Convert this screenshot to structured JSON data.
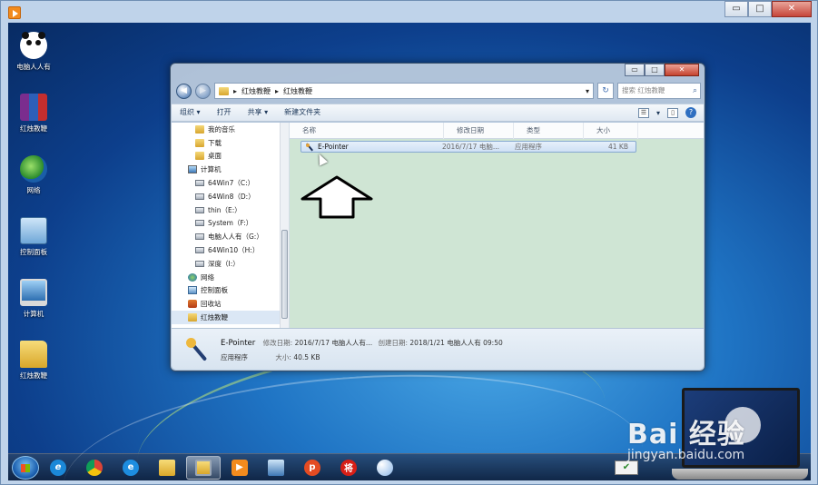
{
  "frame": {
    "controls": [
      "▭",
      "□",
      "✕"
    ]
  },
  "desktop": {
    "icons": [
      {
        "label": "电脑人人有",
        "icon": "panda-icon"
      },
      {
        "label": "红烛教鞭",
        "icon": "winrar-icon"
      },
      {
        "label": "网络",
        "icon": "network-icon"
      },
      {
        "label": "控制面板",
        "icon": "control-panel-icon"
      },
      {
        "label": "计算机",
        "icon": "computer-icon"
      },
      {
        "label": "红烛教鞭",
        "icon": "folder-icon"
      }
    ]
  },
  "explorer": {
    "controls": [
      "▭",
      "□",
      "✕"
    ],
    "back": "◀",
    "forward": "▶",
    "address": {
      "sep": "▸",
      "crumbs": [
        "红烛教鞭",
        "红烛教鞭"
      ],
      "dropdown": "▾"
    },
    "refresh": "↻",
    "search_placeholder": "搜索 红烛教鞭",
    "search_icon": "⌕",
    "toolbar": {
      "organize": "组织 ▾",
      "open": "打开",
      "share": "共享 ▾",
      "new_folder": "新建文件夹",
      "view": "☰",
      "view_dd": "▾",
      "pane": "▯",
      "help": "?"
    },
    "nav": [
      {
        "label": "我的音乐",
        "icon": "folder"
      },
      {
        "label": "下载",
        "icon": "folder"
      },
      {
        "label": "桌面",
        "icon": "folder"
      },
      {
        "label": "计算机",
        "icon": "computer"
      },
      {
        "label": "64Win7（C:）",
        "icon": "drive"
      },
      {
        "label": "64Win8（D:）",
        "icon": "drive"
      },
      {
        "label": "thin（E:）",
        "icon": "drive"
      },
      {
        "label": "System（F:）",
        "icon": "drive"
      },
      {
        "label": "电脑人人有（G:）",
        "icon": "drive"
      },
      {
        "label": "64Win10（H:）",
        "icon": "drive"
      },
      {
        "label": "深度（I:）",
        "icon": "drive"
      },
      {
        "label": "网络",
        "icon": "network"
      },
      {
        "label": "控制面板",
        "icon": "control-panel"
      },
      {
        "label": "回收站",
        "icon": "recycle-bin"
      },
      {
        "label": "红烛教鞭",
        "icon": "folder"
      }
    ],
    "columns": [
      "名称",
      "修改日期",
      "类型",
      "大小"
    ],
    "file": {
      "name": "E-Pointer",
      "date": "2016/7/17 电脑...",
      "type": "应用程序",
      "size": "41 KB"
    },
    "details": {
      "name": "E-Pointer",
      "modified_label": "修改日期:",
      "modified": "2016/7/17 电脑人人有...",
      "created_label": "创建日期:",
      "created": "2018/1/21 电脑人人有 09:50",
      "type": "应用程序",
      "size_label": "大小:",
      "size": "40.5 KB"
    }
  },
  "taskbar": {
    "items": [
      {
        "name": "ie",
        "label": "e"
      },
      {
        "name": "chrome",
        "label": ""
      },
      {
        "name": "360-browser",
        "label": "e"
      },
      {
        "name": "folder",
        "label": ""
      },
      {
        "name": "file-explorer",
        "label": ""
      },
      {
        "name": "video-player",
        "label": "▶"
      },
      {
        "name": "remote-desktop",
        "label": ""
      },
      {
        "name": "p-app",
        "label": "p"
      },
      {
        "name": "jiang-app",
        "label": "将"
      },
      {
        "name": "paint",
        "label": ""
      }
    ],
    "tray_icon": "✔"
  },
  "watermark": {
    "logo": "Bai 经验",
    "url": "jingyan.baidu.com"
  }
}
